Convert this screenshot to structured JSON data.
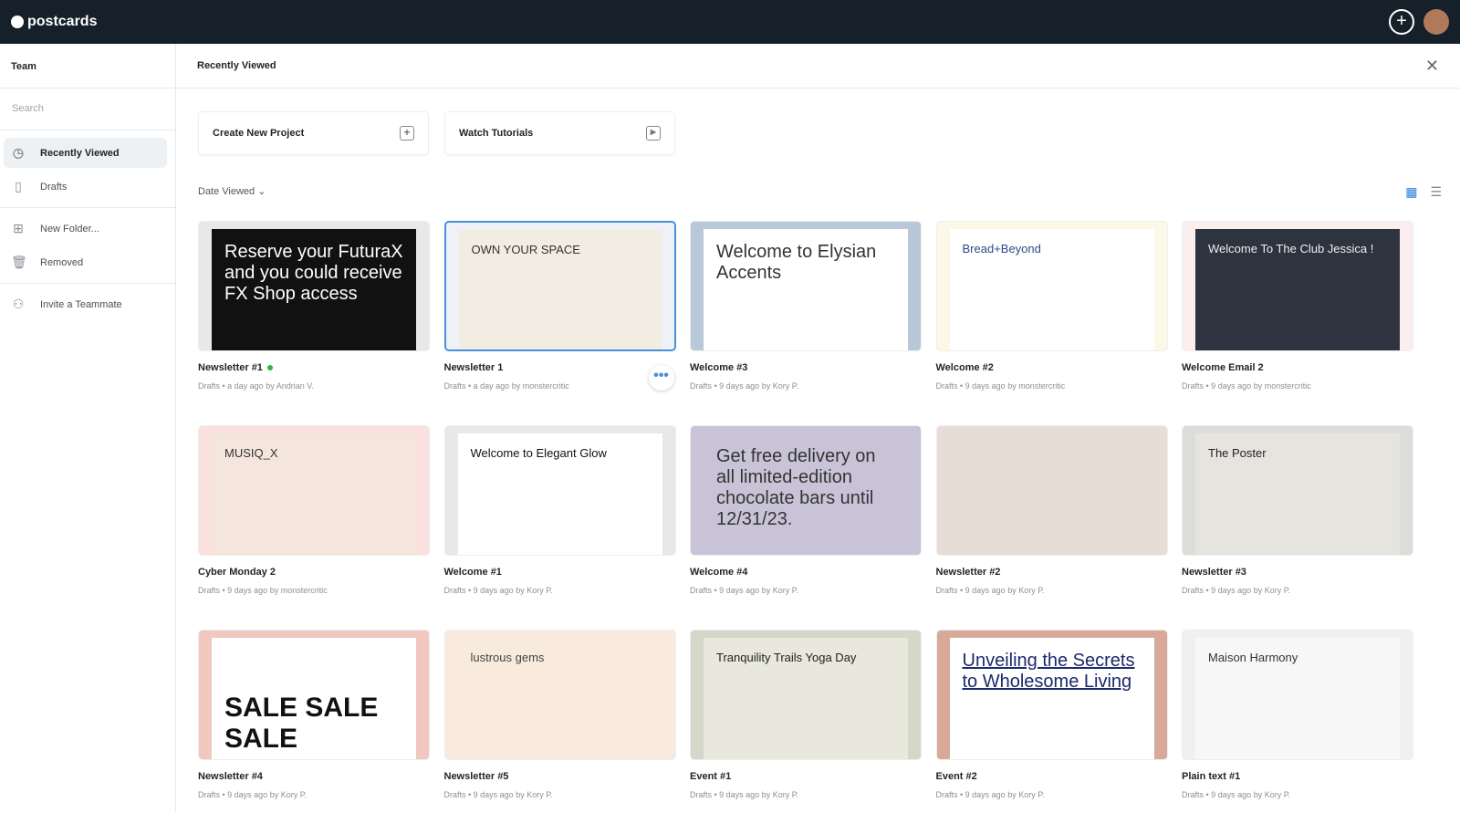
{
  "app": {
    "name": "postcards"
  },
  "sidebar": {
    "team": "Team",
    "search_placeholder": "Search",
    "items": [
      {
        "label": "Recently Viewed",
        "icon": "clock-icon"
      },
      {
        "label": "Drafts",
        "icon": "file-icon"
      },
      {
        "label": "New Folder...",
        "icon": "folder-plus-icon"
      },
      {
        "label": "Removed",
        "icon": "trash-icon"
      },
      {
        "label": "Invite a Teammate",
        "icon": "user-plus-icon"
      }
    ]
  },
  "main": {
    "title": "Recently Viewed",
    "create": "Create New Project",
    "tutorials": "Watch Tutorials",
    "sort": "Date Viewed",
    "cards": [
      {
        "title": "Newsletter #1",
        "meta": "Drafts  •  a day ago by Andrian V.",
        "thumb": "Reserve your FuturaX and you could receive FX Shop access",
        "bg": "#e8e8e8",
        "fg": "#111",
        "tc": "#fff",
        "online": true
      },
      {
        "title": "Newsletter 1",
        "meta": "Drafts  •  a day ago by monstercritic",
        "thumb": "OWN YOUR SPACE",
        "bg": "#eef2f6",
        "fg": "#f3ece2",
        "tc": "#333",
        "selected": true
      },
      {
        "title": "Welcome #3",
        "meta": "Drafts  •  9 days ago by Kory P.",
        "thumb": "Welcome to Elysian Accents",
        "bg": "#b8c8d8",
        "fg": "#fff",
        "tc": "#333"
      },
      {
        "title": "Welcome #2",
        "meta": "Drafts  •  9 days ago by monstercritic",
        "thumb": "Bread+Beyond",
        "bg": "#fbf8e8",
        "fg": "#fff",
        "tc": "#2d4a8a"
      },
      {
        "title": "Welcome Email 2",
        "meta": "Drafts  •  9 days ago by monstercritic",
        "thumb": "Welcome To The Club Jessica !",
        "bg": "#fbeeee",
        "fg": "#2e3340",
        "tc": "#eee"
      },
      {
        "title": "Cyber Monday 2",
        "meta": "Drafts  •  9 days ago by monstercritic",
        "thumb": "MUSIQ_X",
        "bg": "#fbe0e0",
        "fg": "#f4e6dc",
        "tc": "#333"
      },
      {
        "title": "Welcome #1",
        "meta": "Drafts  •  9 days ago by Kory P.",
        "thumb": "Welcome to Elegant Glow",
        "bg": "#e8e8e8",
        "fg": "#fff",
        "tc": "#111"
      },
      {
        "title": "Welcome #4",
        "meta": "Drafts  •  9 days ago by Kory P.",
        "thumb": "Get free delivery on all limited-edition chocolate bars until 12/31/23.",
        "bg": "#c9c3d8",
        "fg": "#c9c3d8",
        "tc": "#333"
      },
      {
        "title": "Newsletter #2",
        "meta": "Drafts  •  9 days ago by Kory P.",
        "thumb": "",
        "bg": "#e8ddd6",
        "fg": "#e6ddd5",
        "tc": "#333"
      },
      {
        "title": "Newsletter #3",
        "meta": "Drafts  •  9 days ago by Kory P.",
        "thumb": "The Poster",
        "bg": "#dcdcd8",
        "fg": "#e6e4df",
        "tc": "#222"
      },
      {
        "title": "Newsletter #4",
        "meta": "Drafts  •  9 days ago by Kory P.",
        "thumb": "SALE SALE SALE",
        "bg": "#f0c8c0",
        "fg": "#fff",
        "tc": "#111"
      },
      {
        "title": "Newsletter #5",
        "meta": "Drafts  •  9 days ago by Kory P.",
        "thumb": "lustrous gems",
        "bg": "#f8eadc",
        "fg": "#f8eadc",
        "tc": "#444"
      },
      {
        "title": "Event #1",
        "meta": "Drafts  •  9 days ago by Kory P.",
        "thumb": "Tranquility Trails Yoga Day",
        "bg": "#d4d8c8",
        "fg": "#e8e8dc",
        "tc": "#222"
      },
      {
        "title": "Event #2",
        "meta": "Drafts  •  9 days ago by Kory P.",
        "thumb": "Unveiling the Secrets to Wholesome Living",
        "bg": "#d8a898",
        "fg": "#fff",
        "tc": "#1a2a6a"
      },
      {
        "title": "Plain text #1",
        "meta": "Drafts  •  9 days ago by Kory P.",
        "thumb": "Maison Harmony",
        "bg": "#f0f0f0",
        "fg": "#f7f7f7",
        "tc": "#333"
      }
    ]
  }
}
